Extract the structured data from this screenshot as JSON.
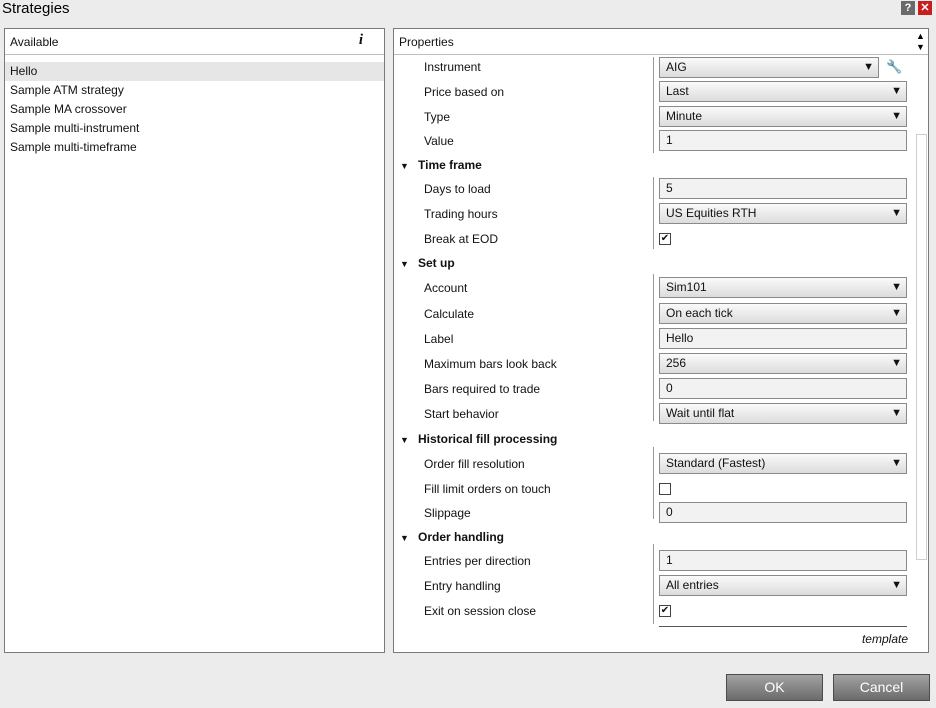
{
  "window": {
    "title": "Strategies",
    "help_glyph": "?",
    "close_glyph": "✕"
  },
  "available": {
    "header": "Available",
    "info_glyph": "i",
    "items": [
      "Hello",
      "Sample ATM strategy",
      "Sample MA crossover",
      "Sample multi-instrument",
      "Sample multi-timeframe"
    ],
    "selected": "Hello"
  },
  "properties": {
    "header": "Properties",
    "rows": {
      "instrument": {
        "label": "Instrument",
        "value": "AIG"
      },
      "price_based_on": {
        "label": "Price based on",
        "value": "Last"
      },
      "type": {
        "label": "Type",
        "value": "Minute"
      },
      "value": {
        "label": "Value",
        "value": "1"
      },
      "time_frame": {
        "label": "Time frame"
      },
      "days_to_load": {
        "label": "Days to load",
        "value": "5"
      },
      "trading_hours": {
        "label": "Trading hours",
        "value": "US Equities RTH"
      },
      "break_at_eod": {
        "label": "Break at EOD",
        "checked": true
      },
      "set_up": {
        "label": "Set up"
      },
      "account": {
        "label": "Account",
        "value": "Sim101"
      },
      "calculate": {
        "label": "Calculate",
        "value": "On each tick"
      },
      "label": {
        "label": "Label",
        "value": "Hello"
      },
      "max_bars_look_back": {
        "label": "Maximum bars look back",
        "value": "256"
      },
      "bars_required_to_trade": {
        "label": "Bars required to trade",
        "value": "0"
      },
      "start_behavior": {
        "label": "Start behavior",
        "value": "Wait until flat"
      },
      "historical_fill_processing": {
        "label": "Historical fill processing"
      },
      "order_fill_resolution": {
        "label": "Order fill resolution",
        "value": "Standard (Fastest)"
      },
      "fill_limit_orders_on_touch": {
        "label": "Fill limit orders on touch",
        "checked": false
      },
      "slippage": {
        "label": "Slippage",
        "value": "0"
      },
      "order_handling": {
        "label": "Order handling"
      },
      "entries_per_direction": {
        "label": "Entries per direction",
        "value": "1"
      },
      "entry_handling": {
        "label": "Entry handling",
        "value": "All entries"
      },
      "exit_on_session_close": {
        "label": "Exit on session close",
        "checked": true
      }
    },
    "template_link": "template"
  },
  "buttons": {
    "ok": "OK",
    "cancel": "Cancel"
  }
}
